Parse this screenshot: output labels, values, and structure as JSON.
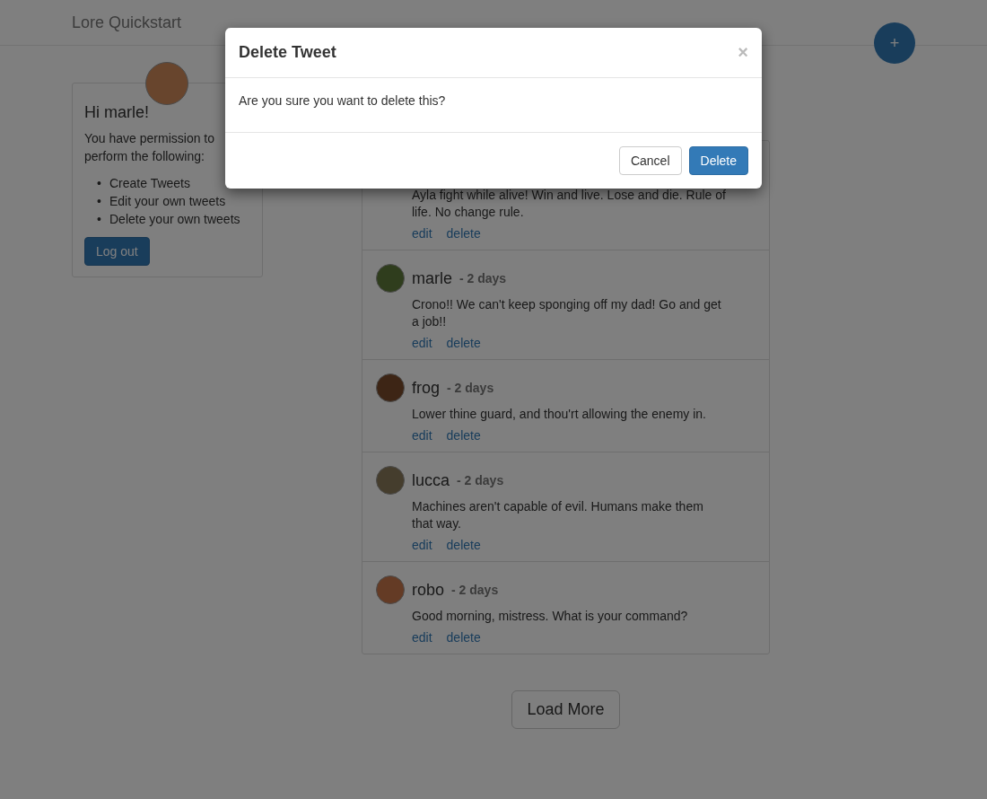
{
  "navbar": {
    "brand": "Lore Quickstart",
    "add_button": "+"
  },
  "profile": {
    "greeting": "Hi marle!",
    "intro": "You have permission to perform the following:",
    "permissions": [
      {
        "bullet": "•",
        "text": "Create Tweets"
      },
      {
        "bullet": "•",
        "text": "Edit your own tweets"
      },
      {
        "bullet": "•",
        "text": "Delete your own tweets"
      }
    ],
    "logout": "Log out"
  },
  "tweets": [
    {
      "text": "Ayla fight while alive! Win and live. Lose and die. Rule of life. No change rule.",
      "actions": [
        "edit",
        "delete"
      ]
    },
    {
      "author": "marle",
      "time": "- 2 days",
      "text": "Crono!! We can't keep sponging off my dad! Go and get a job!!",
      "actions": [
        "edit",
        "delete"
      ]
    },
    {
      "author": "frog",
      "time": "- 2 days",
      "text": "Lower thine guard, and thou'rt allowing the enemy in.",
      "actions": [
        "edit",
        "delete"
      ]
    },
    {
      "author": "lucca",
      "time": "- 2 days",
      "text": "Machines aren't capable of evil. Humans make them that way.",
      "actions": [
        "edit",
        "delete"
      ]
    },
    {
      "author": "robo",
      "time": "- 2 days",
      "text": "Good morning, mistress. What is your command?",
      "actions": [
        "edit",
        "delete"
      ]
    }
  ],
  "load_more": "Load More",
  "modal": {
    "title": "Delete Tweet",
    "close": "×",
    "message": "Are you sure you want to delete this?",
    "buttons": [
      {
        "label": "Cancel",
        "kind": "default"
      },
      {
        "label": "Delete",
        "kind": "primary"
      }
    ]
  }
}
